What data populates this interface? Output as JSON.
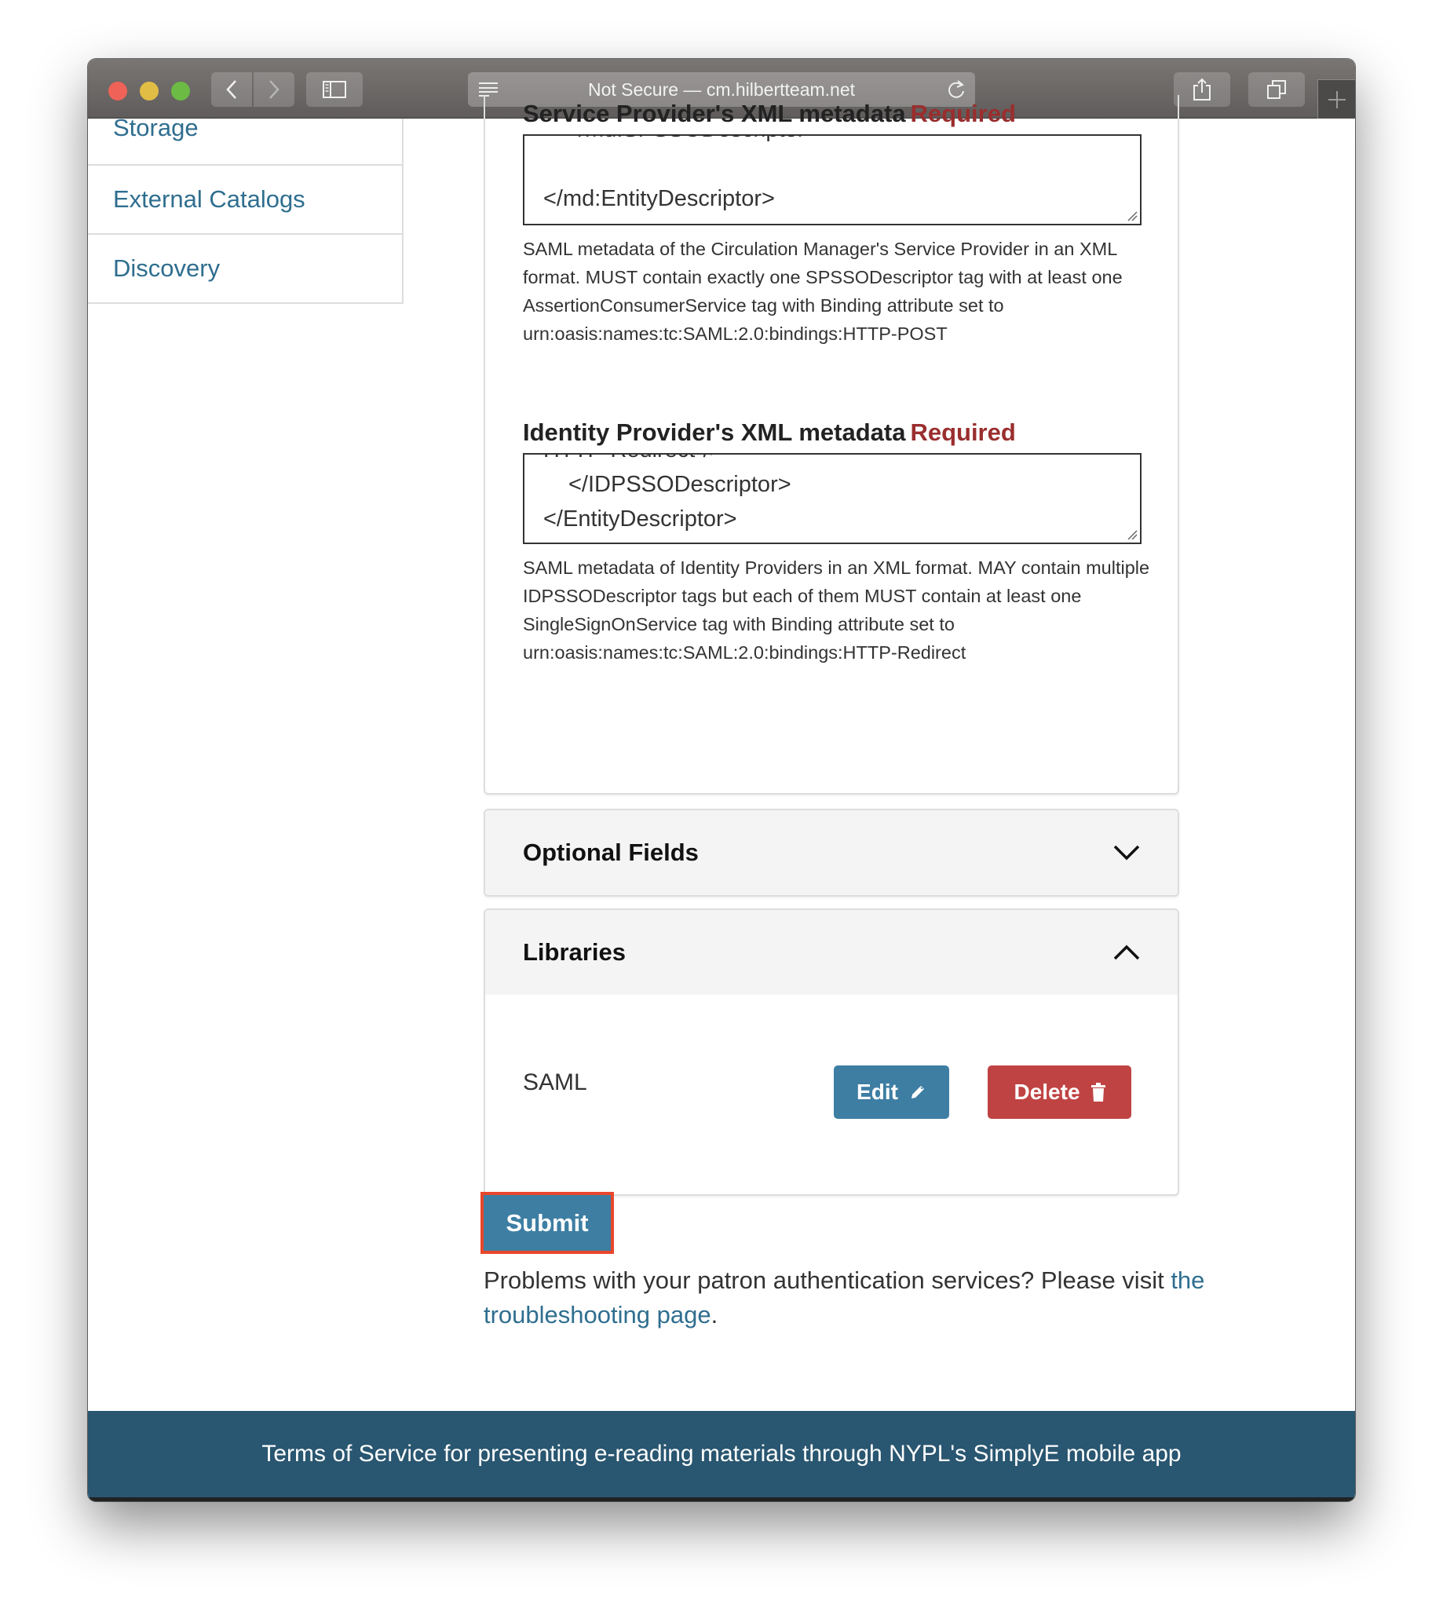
{
  "browser": {
    "url_text": "Not Secure — cm.hilbertteam.net",
    "icons": {
      "back": "chevron-left-icon",
      "forward": "chevron-right-icon",
      "sidebar": "sidebar-icon",
      "reader": "reader-lines-icon",
      "reload": "reload-icon",
      "share": "share-icon",
      "tabs": "tabs-overview-icon",
      "new_tab": "plus-icon"
    }
  },
  "sidebar": {
    "items": [
      {
        "label": "Storage"
      },
      {
        "label": "External Catalogs"
      },
      {
        "label": "Discovery"
      }
    ]
  },
  "form": {
    "sp_metadata": {
      "label": "Service Provider's XML metadata",
      "required": "Required",
      "partial_line": "</md:SPSSODescriptor>",
      "value_last_line": "</md:EntityDescriptor>",
      "help": "SAML metadata of the Circulation Manager's Service Provider in an XML format. MUST contain exactly one SPSSODescriptor tag with at least one AssertionConsumerService tag with Binding attribute set to urn:oasis:names:tc:SAML:2.0:bindings:HTTP-POST"
    },
    "idp_metadata": {
      "label": "Identity Provider's XML metadata",
      "required": "Required",
      "partial_line": "HTTP-Redirect\"/>",
      "value_line1": "</IDPSSODescriptor>",
      "value_line2": "</EntityDescriptor>",
      "help": "SAML metadata of Identity Providers in an XML format. MAY contain multiple IDPSSODescriptor tags but each of them MUST contain at least one SingleSignOnService tag with Binding attribute set to urn:oasis:names:tc:SAML:2.0:bindings:HTTP-Redirect"
    },
    "optional_fields": {
      "title": "Optional Fields",
      "state": "collapsed"
    },
    "libraries": {
      "title": "Libraries",
      "state": "expanded",
      "items": [
        {
          "name": "SAML",
          "edit_label": "Edit",
          "delete_label": "Delete"
        }
      ]
    },
    "submit_label": "Submit",
    "trouble_text": "Problems with your patron authentication services? Please visit ",
    "trouble_link": "the troubleshooting page",
    "trouble_end": "."
  },
  "footer": {
    "text": "Terms of Service for presenting e-reading materials through NYPL's SimplyE mobile app"
  },
  "colors": {
    "link": "#2f6e8f",
    "primary_button": "#3e7ea3",
    "danger_button": "#c04343",
    "required": "#9a2e2e",
    "footer_bg": "#295670",
    "highlight_outline": "#e8472b"
  }
}
